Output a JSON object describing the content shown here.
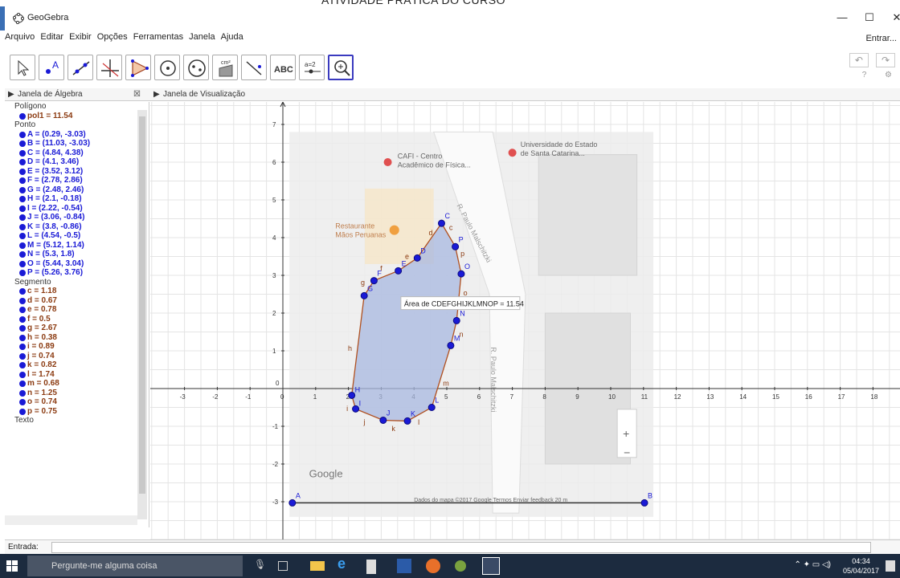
{
  "page_header": "ATIVIDADE PRÁTICA DO CURSO",
  "window": {
    "title": "GeoGebra",
    "minimize": "—",
    "maximize": "☐",
    "close": "✕"
  },
  "menu": {
    "items": [
      "Arquivo",
      "Editar",
      "Exibir",
      "Opções",
      "Ferramentas",
      "Janela",
      "Ajuda"
    ],
    "login": "Entrar..."
  },
  "toolbar": {
    "tools": [
      "move-tool",
      "point-tool",
      "line-tool",
      "perpendicular-tool",
      "polygon-tool",
      "circle-tool",
      "ellipse-tool",
      "area-tool",
      "slope-tool",
      "text-tool",
      "slider-tool",
      "zoom-tool"
    ],
    "text_tool_label": "ABC",
    "slider_tool_label": "a=2",
    "area_tool_label": "cm²",
    "undo": "↶",
    "redo": "↷",
    "help_icon": "?",
    "settings_icon": "⚙"
  },
  "panels": {
    "algebra_title": "Janela de Álgebra",
    "graphics_title": "Janela de Visualização"
  },
  "algebra": {
    "categories": {
      "polygon": "Polígono",
      "point": "Ponto",
      "segment": "Segmento",
      "text": "Texto"
    },
    "polygons": [
      "pol1 = 11.54"
    ],
    "points": [
      "A = (0.29, -3.03)",
      "B = (11.03, -3.03)",
      "C = (4.84, 4.38)",
      "D = (4.1, 3.46)",
      "E = (3.52, 3.12)",
      "F = (2.78, 2.86)",
      "G = (2.48, 2.46)",
      "H = (2.1, -0.18)",
      "I = (2.22, -0.54)",
      "J = (3.06, -0.84)",
      "K = (3.8, -0.86)",
      "L = (4.54, -0.5)",
      "M = (5.12, 1.14)",
      "N = (5.3, 1.8)",
      "O = (5.44, 3.04)",
      "P = (5.26, 3.76)"
    ],
    "segments": [
      "c = 1.18",
      "d = 0.67",
      "e = 0.78",
      "f = 0.5",
      "g = 2.67",
      "h = 0.38",
      "i = 0.89",
      "j = 0.74",
      "k = 0.82",
      "l = 1.74",
      "m = 0.68",
      "n = 1.25",
      "o = 0.74",
      "p = 0.75"
    ]
  },
  "chart_data": {
    "type": "scatter",
    "xlim": [
      -3.2,
      18.3
    ],
    "ylim": [
      -3.4,
      7.5
    ],
    "grid": true,
    "x_ticks": [
      -3,
      -2,
      -1,
      0,
      1,
      2,
      3,
      4,
      5,
      6,
      7,
      8,
      9,
      10,
      11,
      12,
      13,
      14,
      15,
      16,
      17,
      18
    ],
    "y_ticks": [
      -3,
      -2,
      -1,
      0,
      1,
      2,
      3,
      4,
      5,
      6,
      7
    ],
    "points": [
      {
        "label": "A",
        "x": 0.29,
        "y": -3.03
      },
      {
        "label": "B",
        "x": 11.03,
        "y": -3.03
      },
      {
        "label": "C",
        "x": 4.84,
        "y": 4.38
      },
      {
        "label": "D",
        "x": 4.1,
        "y": 3.46
      },
      {
        "label": "E",
        "x": 3.52,
        "y": 3.12
      },
      {
        "label": "F",
        "x": 2.78,
        "y": 2.86
      },
      {
        "label": "G",
        "x": 2.48,
        "y": 2.46
      },
      {
        "label": "H",
        "x": 2.1,
        "y": -0.18
      },
      {
        "label": "I",
        "x": 2.22,
        "y": -0.54
      },
      {
        "label": "J",
        "x": 3.06,
        "y": -0.84
      },
      {
        "label": "K",
        "x": 3.8,
        "y": -0.86
      },
      {
        "label": "L",
        "x": 4.54,
        "y": -0.5
      },
      {
        "label": "M",
        "x": 5.12,
        "y": 1.14
      },
      {
        "label": "N",
        "x": 5.3,
        "y": 1.8
      },
      {
        "label": "O",
        "x": 5.44,
        "y": 3.04
      },
      {
        "label": "P",
        "x": 5.26,
        "y": 3.76
      }
    ],
    "polygon_order": [
      "C",
      "D",
      "E",
      "F",
      "G",
      "H",
      "I",
      "J",
      "K",
      "L",
      "M",
      "N",
      "O",
      "P"
    ],
    "segment_labels": [
      "d",
      "e",
      "f",
      "g",
      "h",
      "i",
      "j",
      "k",
      "l",
      "m",
      "n",
      "o",
      "p",
      "c"
    ],
    "area_label": "Área de  CDEFGHIJKLMNOP = 11.54",
    "colors": {
      "polygon_fill": "#a8b8e0",
      "polygon_stroke": "#b05020",
      "point": "#1a1ad6",
      "segment_label": "#8b3a10"
    }
  },
  "map": {
    "labels": {
      "cafi": "CAFI - Centro\nAcadêmico de Física...",
      "udesc": "Universidade do Estado\nde Santa Catarina...",
      "restaurant": "Restaurante\nMãos Peruanas",
      "street1": "R. Paulo Malschitzki",
      "street2": "R. Paulo Malschitzki"
    },
    "google": "Google",
    "footer": "Dados do mapa ©2017 Google   Termos   Enviar feedback   20 m",
    "zoom_in": "+",
    "zoom_out": "−"
  },
  "input": {
    "label": "Entrada:"
  },
  "taskbar": {
    "search_placeholder": "Pergunte-me alguma coisa",
    "time": "04:34",
    "date": "05/04/2017"
  }
}
